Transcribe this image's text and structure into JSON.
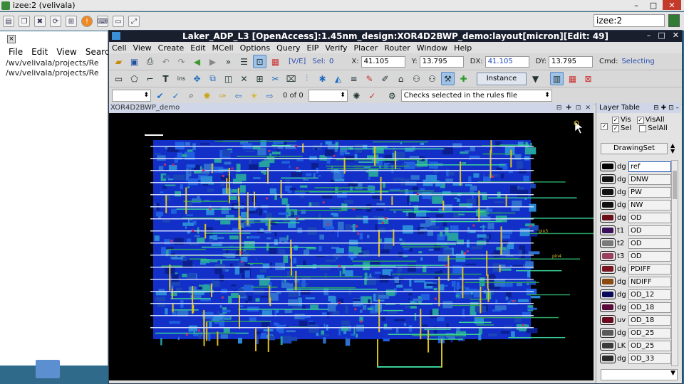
{
  "vnc": {
    "title": "izee:2 (velivala)",
    "right_title": "izee:2"
  },
  "bg_window": {
    "menus": [
      "File",
      "Edit",
      "View",
      "Search"
    ],
    "paths": [
      "/wv/velivala/projects/Re",
      "/wv/velivala/projects/Re"
    ]
  },
  "main": {
    "title": "Laker_ADP_L3 [OpenAccess]:1.45nm_design:XOR4D2BWP_demo:layout[micron][Edit: 49]",
    "menus": [
      "Cell",
      "View",
      "Create",
      "Edit",
      "MCell",
      "Options",
      "Query",
      "EIP",
      "Verify",
      "Placer",
      "Router",
      "Window",
      "Help"
    ],
    "toolbar1": {
      "ve": "[V/E]",
      "sel_label": "Sel:",
      "sel_value": "0",
      "x_label": "X:",
      "x_value": "41.105",
      "y_label": "Y:",
      "y_value": "13.795",
      "dx_label": "DX:",
      "dx_value": "41.105",
      "dy_label": "DY:",
      "dy_value": "13.795",
      "cmd_label": "Cmd:",
      "cmd_value": "Selecting"
    },
    "toolbar2": {
      "instance": "Instance"
    },
    "toolbar3": {
      "count": "0 of 0",
      "rules": "Checks selected in the rules file"
    },
    "doc_title": "XOR4D2BWP_demo",
    "layer_table": {
      "title": "Layer Table",
      "vis": "Vis",
      "visall": "VisAll",
      "sel": "Sel",
      "selall": "SelAll",
      "drawing_set": "DrawingSet",
      "rows": [
        {
          "purpose": "dg",
          "name": "ref",
          "color": "#000000"
        },
        {
          "purpose": "dg",
          "name": "DNW",
          "color": "#111111"
        },
        {
          "purpose": "dg",
          "name": "PW",
          "color": "#111111"
        },
        {
          "purpose": "dg",
          "name": "NW",
          "color": "#111111"
        },
        {
          "purpose": "dg",
          "name": "OD",
          "color": "#6a0f1a"
        },
        {
          "purpose": "t1",
          "name": "OD",
          "color": "#3a0f5a"
        },
        {
          "purpose": "t2",
          "name": "OD",
          "color": "#7a7a7a"
        },
        {
          "purpose": "t3",
          "name": "OD",
          "color": "#9a4060"
        },
        {
          "purpose": "dg",
          "name": "PDIFF",
          "color": "#7a1520"
        },
        {
          "purpose": "dg",
          "name": "NDIFF",
          "color": "#8a4a10"
        },
        {
          "purpose": "dg",
          "name": "OD_12",
          "color": "#0a0a5a"
        },
        {
          "purpose": "dg",
          "name": "OD_18",
          "color": "#5a0a3a"
        },
        {
          "purpose": "uv",
          "name": "OD_18",
          "color": "#6a0a20"
        },
        {
          "purpose": "dg",
          "name": "OD_25",
          "color": "#5a5a5a"
        },
        {
          "purpose": "LK",
          "name": "OD_25",
          "color": "#3a3a3a"
        },
        {
          "purpose": "dg",
          "name": "OD_33",
          "color": "#2a2a2a"
        }
      ]
    }
  },
  "canvas_labels": [
    "pin3",
    "pin4"
  ]
}
